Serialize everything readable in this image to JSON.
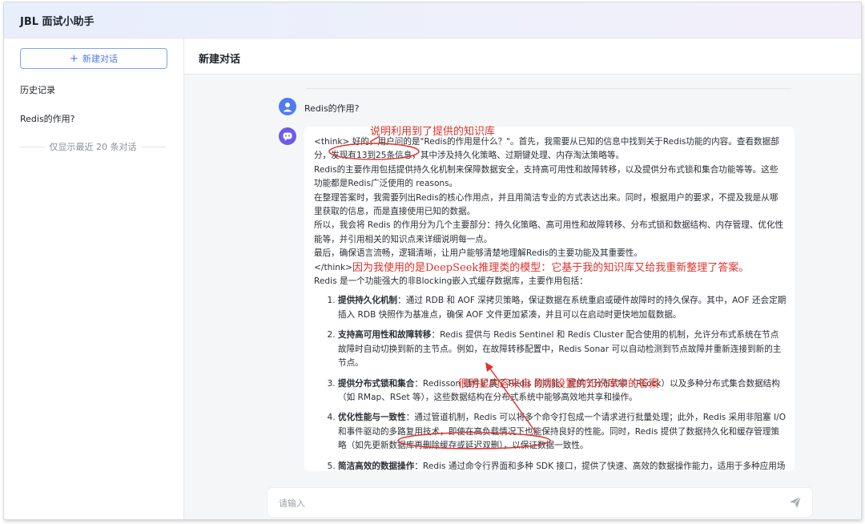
{
  "app": {
    "title": "JBL 面试小助手"
  },
  "sidebar": {
    "new_chat_plus": "+",
    "new_chat_label": "新建对话",
    "history_title": "历史记录",
    "history_items": [
      "Redis的作用?"
    ],
    "history_note": "仅显示最近 20 条对话"
  },
  "conversation": {
    "title": "新建对话",
    "user_message": "Redis的作用?",
    "think": {
      "lines": [
        "<think> 好的，用户问的是\"Redis的作用是什么？\"。首先，我需要从已知的信息中找到关于Redis功能的内容。查看数据部分，发现有13到25条信息，其中涉及持久化策略、过期键处理、内存淘汰策略等。",
        "Redis的主要作用包括提供持久化机制来保障数据安全，支持高可用性和故障转移，以及提供分布式锁和集合功能等等。这些功能都是Redis广泛使用的 reasons。",
        "在整理答案时，我需要列出Redis的核心作用点，并且用简洁专业的方式表达出来。同时，根据用户的要求，不提及我是从哪里获取的信息，而是直接使用已知的数据。",
        "所以，我会将 Redis 的作用分为几个主要部分：持久化策略、高可用性和故障转移、分布式锁和数据结构、内存管理、优化性能等，并引用相关的知识点来详细说明每一点。",
        "最后，确保语言流畅，逻辑清晰，让用户能够清楚地理解Redis的主要功能及其重要性。"
      ],
      "close_tag": "</think>"
    },
    "intro": "Redis 是一个功能强大的非Blocking嵌入式缓存数据库，主要作用包括：",
    "points": [
      {
        "title": "提供持久化机制",
        "text": "：通过 RDB 和 AOF 深拷贝策略，保证数据在系统重启或硬件故障时的持久保存。其中，AOF 还会定期插入 RDB 快照作为基准点，确保 AOF 文件更加紧凑，并且可以在启动时更快地加载数据。"
      },
      {
        "title": "支持高可用性和故障转移",
        "text": "：Redis 提供与 Redis Sentinel 和 Redis Cluster 配合使用的机制，允许分布式系统在节点故障时自动切换到新的主节点。例如，在故障转移配置中，Redis Sonar 可以自动检测到节点故障并重新连接到新的主节点。"
      },
      {
        "title": "提供分布式锁和集合",
        "text": "：Redisson 插件扩展了 Redis 的功能，提供了分布式锁（RLock）以及多种分布式集合数据结构（如 RMap、RSet 等），这些数据结构在分布式系统中能够高效地共享和操作。"
      },
      {
        "title": "优化性能与一致性",
        "text": "：通过管道机制，Redis 可以将多个命令打包成一个请求进行批量处理；此外，Redis 采用非阻塞 I/O 和事件驱动的多路复用技术，即使在高负载情况下也能保持良好的性能。同时，Redis 提供了数据持久化和缓存管理策略（如先更新数据库再删除缓存或延迟双删），以保证数据一致性。"
      },
      {
        "title": "简洁高效的数据操作",
        "text": "：Redis 通过命令行界面和多种 SDK 接口，提供了快速、高效的数据操作能力，适用于多种应用场景。"
      }
    ]
  },
  "input": {
    "placeholder": "请输入"
  },
  "annotations": {
    "note1": "说明利用到了提供的知识库",
    "note2": "因为我使用的是DeepSeek推理类的模型：它基于我的知识库又给我重新整理了答案。",
    "note3": "很明显内容来自 刚刚设置的知识库中的答案"
  },
  "colors": {
    "accent": "#4a7ee8",
    "annotation": "#e0312b",
    "bot_avatar": "#6f59e6",
    "user_avatar": "#4f7cf0"
  },
  "icons": {
    "user_avatar": "user-icon",
    "bot_avatar": "chat-bot-icon",
    "send": "send-icon",
    "new_chat": "plus-icon"
  }
}
